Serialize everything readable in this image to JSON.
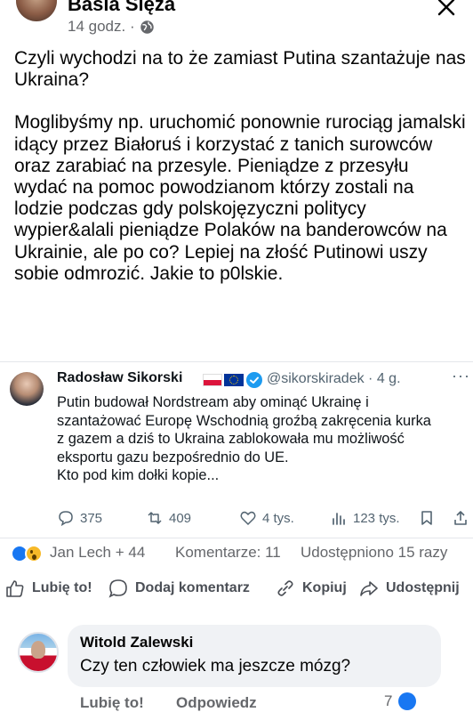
{
  "post": {
    "author": "Basia Ślęza",
    "time": "14 godz. ·",
    "paragraphs": [
      "Czyli wychodzi na to że zamiast Putina szantażuje nas Ukraina?",
      "Moglibyśmy np. uruchomić ponownie rurociąg jamalski idący przez Białoruś i korzystać z tanich surowców oraz zarabiać na przesyle. Pieniądze z przesyłu wydać na pomoc powodzianom którzy zostali na lodzie podczas gdy polskojęzyczni politycy wypier&alali pieniądze Polaków na banderowców na Ukrainie, ale po co? Lepiej na złość Putinowi uszy sobie odmrozić. Jakie to p0lskie."
    ]
  },
  "embed": {
    "name": "Radosław Sikorski",
    "handle": "@sikorskiradek · 4 g.",
    "more": "···",
    "text_lines": [
      "Putin budował Nordstream aby ominąć Ukrainę i",
      "szantażować Europę Wschodnią groźbą zakręcenia kurka",
      "z gazem a dziś to Ukraina zablokowała mu możliwość",
      "eksportu gazu bezpośrednio do UE.",
      "Kto pod kim dołki kopie..."
    ],
    "replies": "375",
    "reposts": "409",
    "likes": "4 tys.",
    "views": "123 tys."
  },
  "stats": {
    "reactions": "Jan Lech + 44",
    "comments": "Komentarze: 11",
    "shares": "Udostępniono 15 razy"
  },
  "actions": {
    "like": "Lubię to!",
    "comment": "Dodaj komentarz",
    "copy": "Kopiuj",
    "share": "Udostępnij"
  },
  "comment": {
    "author": "Witold Zalewski",
    "text": "Czy ten człowiek ma jeszcze mózg?",
    "like": "Lubię to!",
    "reply": "Odpowiedz",
    "reaction_count": "7"
  },
  "colors": {
    "facebook_blue": "#1877f2",
    "meta_gray": "#65676b",
    "bubble_bg": "#f0f2f5",
    "twitter_text": "#0f1419",
    "twitter_muted": "#536471"
  }
}
